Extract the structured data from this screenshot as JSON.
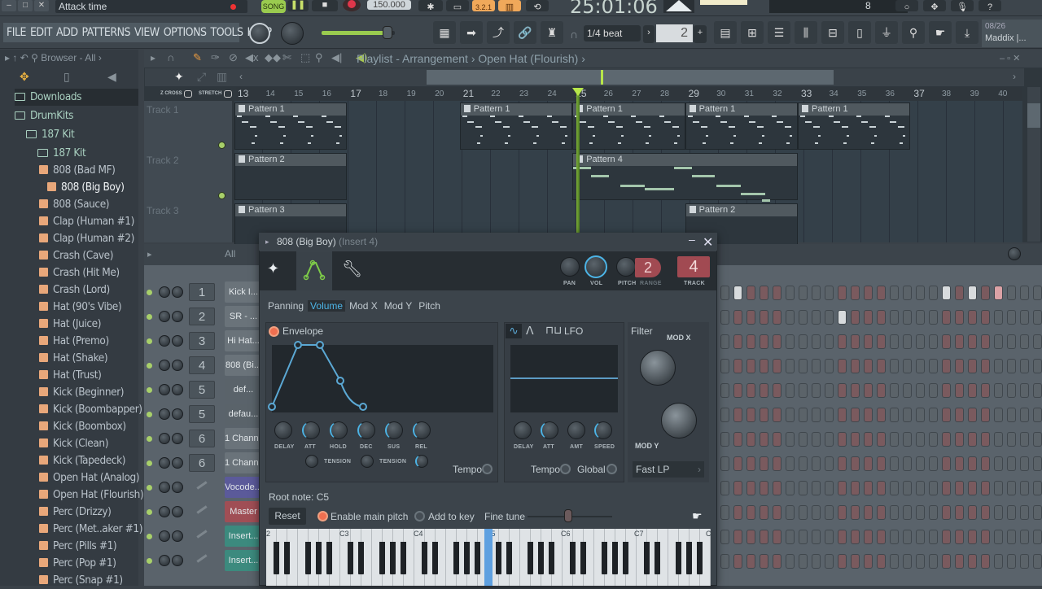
{
  "titlebar": {
    "hint_text": "Attack time",
    "song_mode": "SONG",
    "tempo": "150.000",
    "time_display": "25:01:06",
    "time_sub": "8"
  },
  "menu": {
    "items": [
      "FILE",
      "EDIT",
      "ADD",
      "PATTERNS",
      "VIEW",
      "OPTIONS",
      "TOOLS",
      "HELP"
    ]
  },
  "toolbar": {
    "snap": "1/4 beat",
    "pattern_number": "2",
    "user_date": "08/26",
    "user_name": "Maddix |..."
  },
  "browser": {
    "title": "Browser - All",
    "folders": [
      {
        "label": "Downloads",
        "indent": 0
      },
      {
        "label": "DrumKits",
        "indent": 0
      },
      {
        "label": "187 Kit",
        "indent": 1
      },
      {
        "label": "187 Kit",
        "indent": 2
      }
    ],
    "files": [
      "808 (Bad MF)",
      "808 (Big Boy)",
      "808 (Sauce)",
      "Clap (Human #1)",
      "Clap (Human #2)",
      "Crash (Cave)",
      "Crash (Hit Me)",
      "Crash (Lord)",
      "Hat (90's Vibe)",
      "Hat (Juice)",
      "Hat (Premo)",
      "Hat (Shake)",
      "Hat (Trust)",
      "Kick (Beginner)",
      "Kick (Boombapper)",
      "Kick (Boombox)",
      "Kick (Clean)",
      "Kick (Tapedeck)",
      "Open Hat (Analog)",
      "Open Hat (Flourish)",
      "Perc (Drizzy)",
      "Perc (Met..aker #1)",
      "Perc (Pills #1)",
      "Perc (Pop #1)",
      "Perc (Snap #1)"
    ],
    "selected_file": "808 (Big Boy)"
  },
  "playlist": {
    "title": "Playlist - Arrangement",
    "breadcrumb": "Open Hat (Flourish)",
    "z_cross": "Z CROSS",
    "stretch": "STRETCH",
    "bars": [
      "13",
      "14",
      "15",
      "16",
      "17",
      "18",
      "19",
      "20",
      "21",
      "22",
      "23",
      "24",
      "25",
      "26",
      "27",
      "28",
      "29",
      "30",
      "31",
      "32",
      "33",
      "34",
      "35",
      "36",
      "37",
      "38",
      "39",
      "40"
    ],
    "tracks": [
      "Track 1",
      "Track 2",
      "Track 3"
    ],
    "clips": [
      {
        "track": 0,
        "label": "Pattern 1",
        "start": 13,
        "end": 17
      },
      {
        "track": 0,
        "label": "Pattern 1",
        "start": 21,
        "end": 25
      },
      {
        "track": 0,
        "label": "Pattern 1",
        "start": 25,
        "end": 29
      },
      {
        "track": 0,
        "label": "Pattern 1",
        "start": 29,
        "end": 33
      },
      {
        "track": 0,
        "label": "Pattern 1",
        "start": 33,
        "end": 37
      },
      {
        "track": 1,
        "label": "Pattern 2",
        "start": 13,
        "end": 17
      },
      {
        "track": 1,
        "label": "Pattern 4",
        "start": 25,
        "end": 33
      },
      {
        "track": 2,
        "label": "Pattern 3",
        "start": 13,
        "end": 17
      },
      {
        "track": 2,
        "label": "Pattern 2",
        "start": 29,
        "end": 33
      }
    ],
    "playhead_bar": 25
  },
  "channel_rack": {
    "filter": "All",
    "channels": [
      {
        "num": "1",
        "name": "Kick I...",
        "color": "#6a737a"
      },
      {
        "num": "2",
        "name": "SR - ...",
        "color": "#6a737a"
      },
      {
        "num": "3",
        "name": "Hi Hat...",
        "color": "#6a737a"
      },
      {
        "num": "4",
        "name": "808 (Bi...",
        "color": "#6a737a"
      },
      {
        "num": "5",
        "name": "def...",
        "color": "#5a636a"
      },
      {
        "num": "5",
        "name": "defau...",
        "color": "#5a636a"
      },
      {
        "num": "6",
        "name": "1 Chann...",
        "color": "#6a737a"
      },
      {
        "num": "6",
        "name": "1 Chann...",
        "color": "#6a737a"
      },
      {
        "num": "",
        "name": "Vocode...",
        "color": "#5b5a9a"
      },
      {
        "num": "",
        "name": "Master",
        "color": "#a04e55"
      },
      {
        "num": "",
        "name": "Insert...",
        "color": "#3c8a7e"
      },
      {
        "num": "",
        "name": "Insert...",
        "color": "#3c8a7e"
      }
    ]
  },
  "channel_settings": {
    "title": "808 (Big Boy)",
    "subtitle": "(Insert 4)",
    "knob_labels": {
      "pan": "PAN",
      "vol": "VOL",
      "pitch": "PITCH",
      "range": "RANGE",
      "track": "TRACK"
    },
    "range_value": "2",
    "track_value": "4",
    "target_tabs": [
      "Panning",
      "Volume",
      "Mod X",
      "Mod Y",
      "Pitch"
    ],
    "selected_tab": "Volume",
    "envelope": {
      "label": "Envelope",
      "knobs": [
        "DELAY",
        "ATT",
        "HOLD",
        "DEC",
        "SUS",
        "REL"
      ],
      "tension_label": "TENSION",
      "tempo_label": "Tempo"
    },
    "lfo": {
      "label": "LFO",
      "knobs": [
        "DELAY",
        "ATT",
        "AMT",
        "SPEED"
      ],
      "tempo_label": "Tempo",
      "global_label": "Global"
    },
    "filter": {
      "label": "Filter",
      "mod_x": "MOD X",
      "mod_y": "MOD Y",
      "type": "Fast LP"
    },
    "root_note": "Root note: C5",
    "reset_label": "Reset",
    "enable_main_pitch": "Enable main pitch",
    "add_to_key": "Add to key",
    "fine_tune": "Fine tune",
    "keyboard_labels": [
      "2",
      "C3",
      "C4",
      "C5",
      "C6",
      "C7",
      "C"
    ]
  }
}
